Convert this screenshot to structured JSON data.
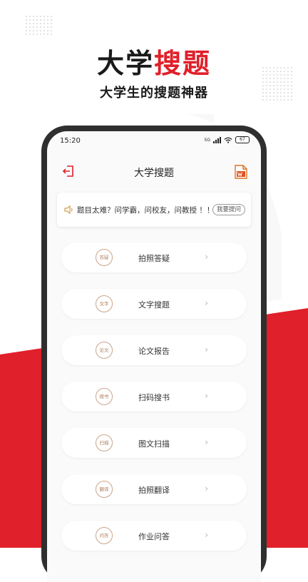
{
  "hero": {
    "title_part1": "大学",
    "title_part2": "搜题",
    "subtitle": "大学生的搜题神器"
  },
  "status_bar": {
    "time": "15:20",
    "battery": "67",
    "network_label": "5G"
  },
  "header": {
    "title": "大学搜题",
    "back_icon": "exit-icon",
    "doc_icon": "word-document-icon"
  },
  "notice": {
    "icon": "speaker-icon",
    "text": "题目太难？问学霸，问校友，问教授 ！！",
    "button": "我要提问"
  },
  "menu": [
    {
      "badge": "答疑",
      "label": "拍照答疑"
    },
    {
      "badge": "文字",
      "label": "文字搜题"
    },
    {
      "badge": "论文",
      "label": "论文报告"
    },
    {
      "badge": "搜书",
      "label": "扫码搜书"
    },
    {
      "badge": "扫描",
      "label": "图文扫描"
    },
    {
      "badge": "翻译",
      "label": "拍照翻译"
    },
    {
      "badge": "问答",
      "label": "作业问答"
    }
  ],
  "colors": {
    "accent": "#e0202a",
    "phone_frame": "#2f2f2f",
    "badge": "#b08060"
  }
}
